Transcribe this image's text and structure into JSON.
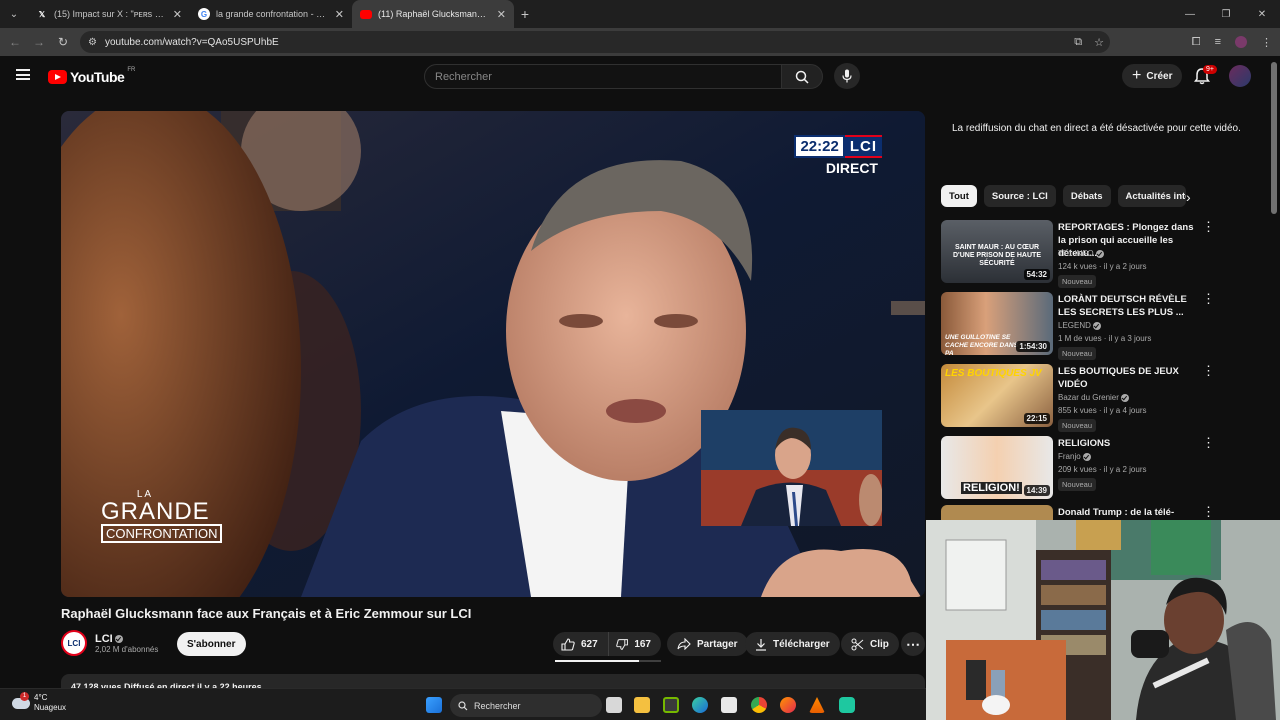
{
  "browser": {
    "tabs": [
      {
        "title": "(15) Impact sur X : \"ᴘᴇʀs FLASH",
        "icon": "x-logo-icon",
        "active": false
      },
      {
        "title": "la grande confrontation - Reche",
        "icon": "google-icon",
        "active": false
      },
      {
        "title": "(11) Raphaël Glucksmann face a",
        "icon": "youtube-icon",
        "active": true
      }
    ],
    "url": "youtube.com/watch?v=QAo5USPUhbE"
  },
  "youtube": {
    "logo_text": "YouTube",
    "country": "FR",
    "search_placeholder": "Rechercher",
    "create_label": "Créer",
    "notifications_badge": "9+"
  },
  "player": {
    "clock": "22:22",
    "channel_logo": "LCI",
    "live_label": "DIRECT",
    "show_logo": {
      "line1": "LA",
      "line2": "GRANDE",
      "line3": "CONFRONTATION"
    }
  },
  "video": {
    "title": "Raphaël Glucksmann face aux Français et à Eric Zemmour sur LCI",
    "channel_name": "LCI",
    "channel_avatar": "LCI",
    "subscribers": "2,02 M d'abonnés",
    "subscribe_label": "S'abonner",
    "likes": "627",
    "dislikes": "167",
    "like_ratio": 0.79,
    "share_label": "Partager",
    "download_label": "Télécharger",
    "clip_label": "Clip",
    "description_stats": "47 128 vues  Diffusé en direct il y a 22 heures"
  },
  "sidebar": {
    "chat_notice": "La rediffusion du chat en direct a été désactivée pour cette vidéo.",
    "chips": [
      "Tout",
      "Source : LCI",
      "Débats",
      "Actualités inte"
    ],
    "recommendations": [
      {
        "title": "REPORTAGES : Plongez dans la prison qui accueille les détenu...",
        "channel": "TF1 INFO",
        "meta": "124 k vues · il y a 2 jours",
        "duration": "54:32",
        "badge": "Nouveau",
        "thumb_text": "SAINT MAUR : AU CŒUR D'UNE PRISON DE HAUTE SÉCURITÉ"
      },
      {
        "title": "LORÀNT DEUTSCH RÉVÈLE LES SECRETS LES PLUS ...",
        "channel": "LEGEND",
        "meta": "1 M de vues · il y a 3 jours",
        "duration": "1:54:30",
        "badge": "Nouveau",
        "thumb_text": "UNE GUILLOTINE SE CACHE ENCORE DANS PA"
      },
      {
        "title": "LES BOUTIQUES DE JEUX VIDÉO",
        "channel": "Bazar du Grenier",
        "meta": "855 k vues · il y a 4 jours",
        "duration": "22:15",
        "badge": "Nouveau",
        "thumb_text": "LES BOUTIQUES JV"
      },
      {
        "title": "RELIGIONS",
        "channel": "Franjo",
        "meta": "209 k vues · il y a 2 jours",
        "duration": "14:39",
        "badge": "Nouveau",
        "thumb_text": "RELIGION!"
      },
      {
        "title": "Donald Trump : de la télé-réalité",
        "channel": "",
        "meta": "",
        "duration": "",
        "badge": "",
        "thumb_text": ""
      }
    ]
  },
  "taskbar": {
    "temperature": "4°C",
    "weather": "Nuageux",
    "weather_badge": "1",
    "search_label": "Rechercher"
  }
}
